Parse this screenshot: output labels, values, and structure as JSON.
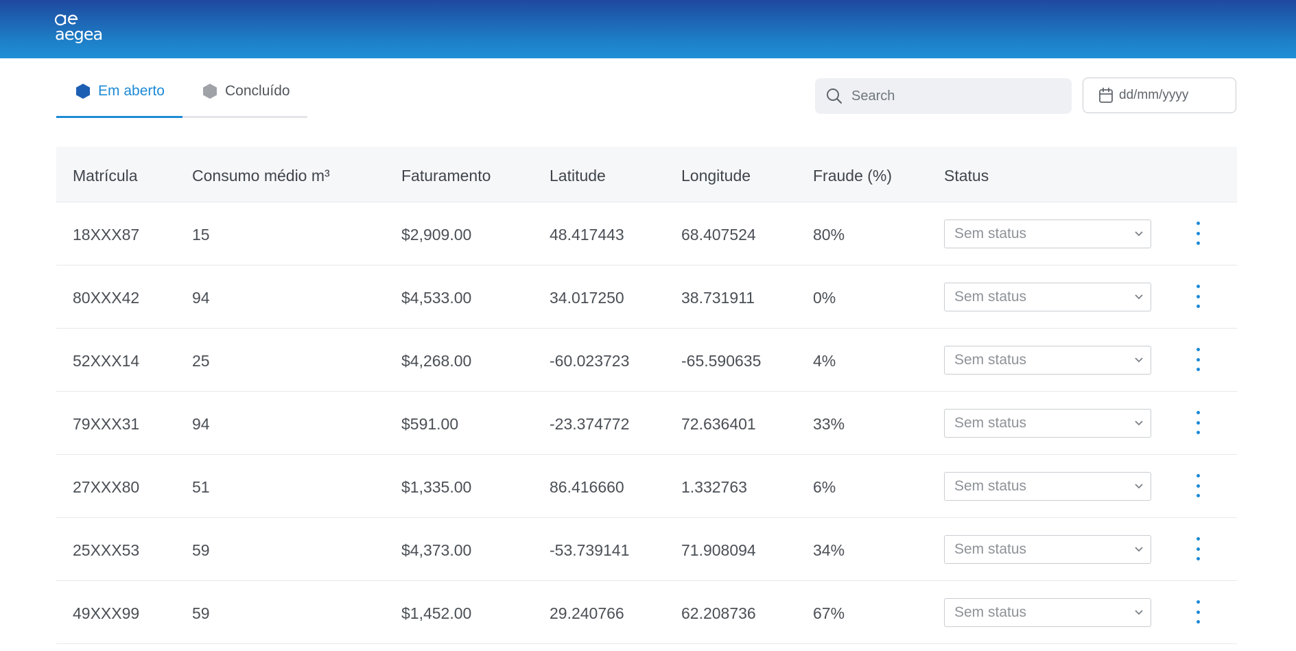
{
  "brand": {
    "name": "aegea",
    "mark": "ae",
    "header_color": "#1f63b5",
    "accent": "#1d8ad6"
  },
  "tabs": [
    {
      "label": "Em aberto",
      "active": true,
      "icon": "hexagon-icon",
      "color": "#1d5fb3"
    },
    {
      "label": "Concluído",
      "active": false,
      "icon": "hexagon-icon",
      "color": "#9fa3a8"
    }
  ],
  "search": {
    "placeholder": "Search",
    "value": ""
  },
  "date_filter": {
    "placeholder": "dd/mm/yyyy",
    "icon": "calendar-icon"
  },
  "table": {
    "columns": [
      "Matrícula",
      "Consumo médio m³",
      "Faturamento",
      "Latitude",
      "Longitude",
      "Fraude (%)",
      "Status"
    ],
    "rows": [
      {
        "matricula": "18XXX87",
        "consumo": "15",
        "faturamento": "$2,909.00",
        "latitude": "48.417443",
        "longitude": "68.407524",
        "fraude": "80%",
        "status": "Sem status"
      },
      {
        "matricula": "80XXX42",
        "consumo": "94",
        "faturamento": "$4,533.00",
        "latitude": "34.017250",
        "longitude": "38.731911",
        "fraude": "0%",
        "status": "Sem status"
      },
      {
        "matricula": "52XXX14",
        "consumo": "25",
        "faturamento": "$4,268.00",
        "latitude": "-60.023723",
        "longitude": "-65.590635",
        "fraude": "4%",
        "status": "Sem status"
      },
      {
        "matricula": "79XXX31",
        "consumo": "94",
        "faturamento": "$591.00",
        "latitude": "-23.374772",
        "longitude": "72.636401",
        "fraude": "33%",
        "status": "Sem status"
      },
      {
        "matricula": "27XXX80",
        "consumo": "51",
        "faturamento": "$1,335.00",
        "latitude": "86.416660",
        "longitude": "1.332763",
        "fraude": "6%",
        "status": "Sem status"
      },
      {
        "matricula": "25XXX53",
        "consumo": "59",
        "faturamento": "$4,373.00",
        "latitude": "-53.739141",
        "longitude": "71.908094",
        "fraude": "34%",
        "status": "Sem status"
      },
      {
        "matricula": "49XXX99",
        "consumo": "59",
        "faturamento": "$1,452.00",
        "latitude": "29.240766",
        "longitude": "62.208736",
        "fraude": "67%",
        "status": "Sem status"
      }
    ]
  }
}
